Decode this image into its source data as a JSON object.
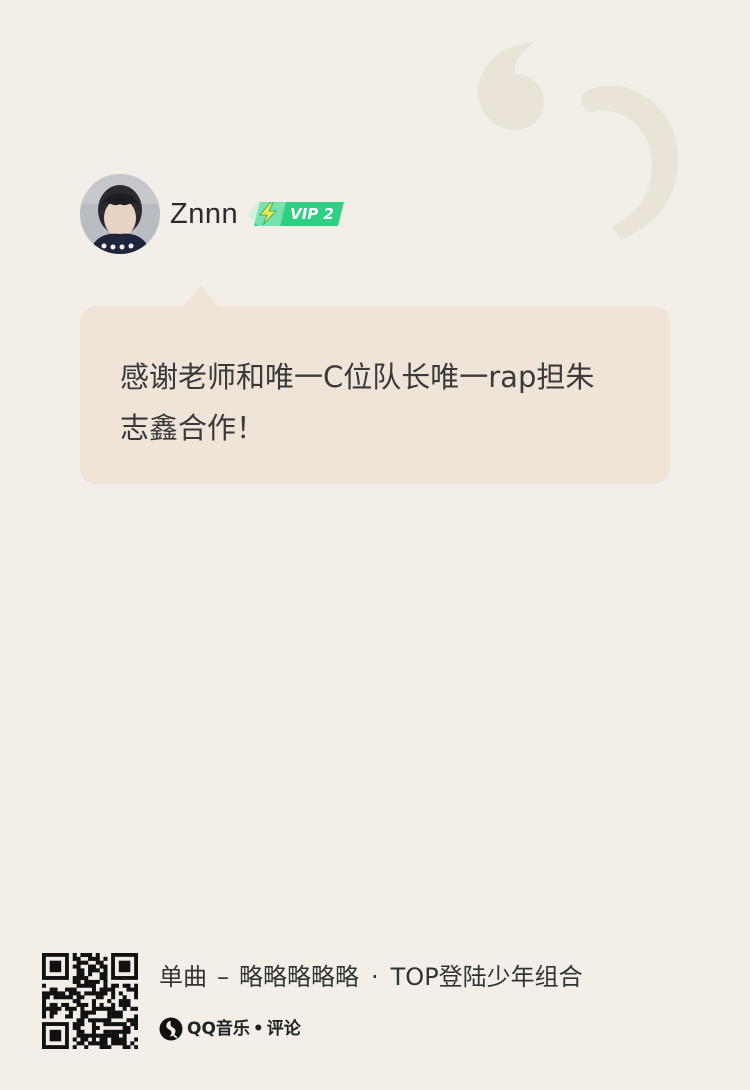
{
  "user": {
    "name": "Znnn",
    "vip_label": "VIP 2",
    "vip_color": "#2ed184"
  },
  "comment": {
    "text": "感谢老师和唯一C位队长唯一rap担朱志鑫合作！"
  },
  "footer": {
    "type_label": "单曲",
    "dash": "–",
    "song_title": "略略略略略",
    "separator": "·",
    "artist": "TOP登陆少年组合",
    "brand_name": "QQ音乐",
    "brand_separator": "•",
    "brand_section": "评论",
    "brand_icon": "qq-music-logo-icon",
    "qr_icon": "qr-code-icon"
  },
  "colors": {
    "background": "#f3efe8",
    "bubble": "#efe4d8",
    "text": "#3a3a3a",
    "vip_green": "#2ed184",
    "decor": "#e9e3da"
  }
}
